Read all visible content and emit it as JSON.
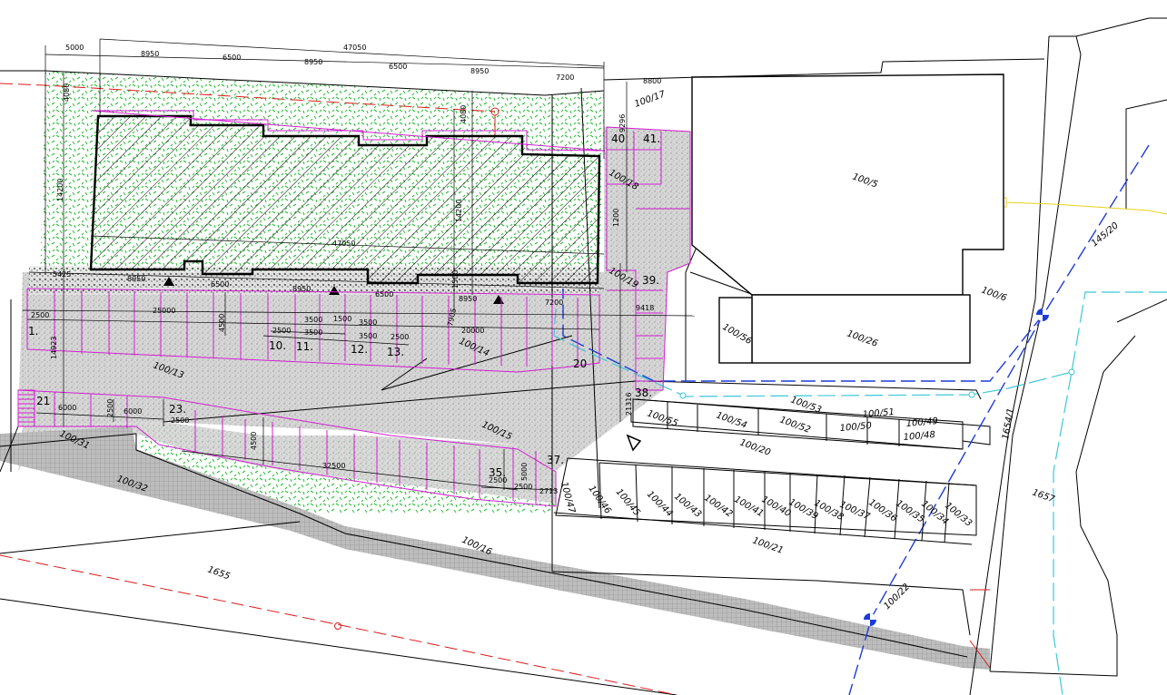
{
  "plan": {
    "colors": {
      "green": "#2fbf3a",
      "gray_paving": "#bdbdbd",
      "magenta": "#d21fd2",
      "red_dash": "#e01b1b",
      "blue_dash": "#1d3bd6",
      "cyan": "#3cc8d8",
      "yellow": "#e8d21a"
    },
    "dimensions": {
      "top_total": "47050",
      "top_5000": "5000",
      "top_8950_a": "8950",
      "top_6500_a": "6500",
      "top_8950_b": "8950",
      "top_6500_b": "6500",
      "top_8950_c": "8950",
      "top_7200": "7200",
      "top_8800": "8800",
      "left_4080": "4080",
      "left_14200": "14200",
      "left_14923": "14923",
      "mid_4080": "4080",
      "mid_14200": "14200",
      "building_47050": "47050",
      "row_5425": "5425",
      "row_8950_a": "8950",
      "row_6500_a": "6500",
      "row_8950_b": "8950",
      "row_6500_b": "6500",
      "row_8950_c": "8950",
      "row_7200": "7200",
      "right_9296": "9296",
      "right_1200": "1200",
      "right_9418": "9418",
      "park_25000": "25000",
      "park_2500_a": "2500",
      "park_4500_a": "4500",
      "park_2500_b": "2500",
      "park_3500_a": "3500",
      "park_1500": "1500",
      "park_3500_b": "3500",
      "park_3500_c": "3500",
      "park_3500_d": "3500",
      "park_2500_c": "2500",
      "park_20000": "20000",
      "mid_1500": "1500",
      "mid_7905": "7905",
      "lower_6000_a": "6000",
      "lower_2500_a": "2500",
      "lower_6000_b": "6000",
      "lower_2500_b": "2500",
      "lower_4500": "4500",
      "lower_32500": "32500",
      "lower_5000": "5000",
      "lower_2500_c": "2500",
      "lower_2500_d": "2500",
      "lower_2713": "2713",
      "right_21316": "21316"
    },
    "parking_numbers": {
      "p1": "1.",
      "p10": "10.",
      "p11": "11.",
      "p12": "12.",
      "p13": "13.",
      "p20": "20",
      "p21": "21",
      "p23": "23.",
      "p35": "35.",
      "p37": "37.",
      "p38": "38.",
      "p39": "39.",
      "p40": "40",
      "p41": "41."
    },
    "parcels": {
      "p100_17": "100/17",
      "p100_18": "100/18",
      "p100_19": "100/19",
      "p100_5": "100/5",
      "p145_20": "145/20",
      "p100_6": "100/6",
      "p100_56": "100/56",
      "p100_26": "100/26",
      "p100_13": "100/13",
      "p100_14": "100/14",
      "p100_15": "100/15",
      "p100_31": "100/31",
      "p100_32": "100/32",
      "p100_55": "100/55",
      "p100_54": "100/54",
      "p100_53": "100/53",
      "p100_52": "100/52",
      "p100_51": "100/51",
      "p100_50": "100/50",
      "p100_49": "100/49",
      "p100_48": "100/48",
      "p100_20": "100/20",
      "p1654_1": "1654/1",
      "p1657": "1657",
      "p100_47": "100/47",
      "p100_46": "100/46",
      "p100_45": "100/45",
      "p100_44": "100/44",
      "p100_43": "100/43",
      "p100_42": "100/42",
      "p100_41": "100/41",
      "p100_40": "100/40",
      "p100_39": "100/39",
      "p100_38": "100/38",
      "p100_37": "100/37",
      "p100_36": "100/36",
      "p100_35": "100/35",
      "p100_34": "100/34",
      "p100_33": "100/33",
      "p100_16": "100/16",
      "p100_21": "100/21",
      "p1655": "1655",
      "p100_22": "100/22"
    }
  }
}
